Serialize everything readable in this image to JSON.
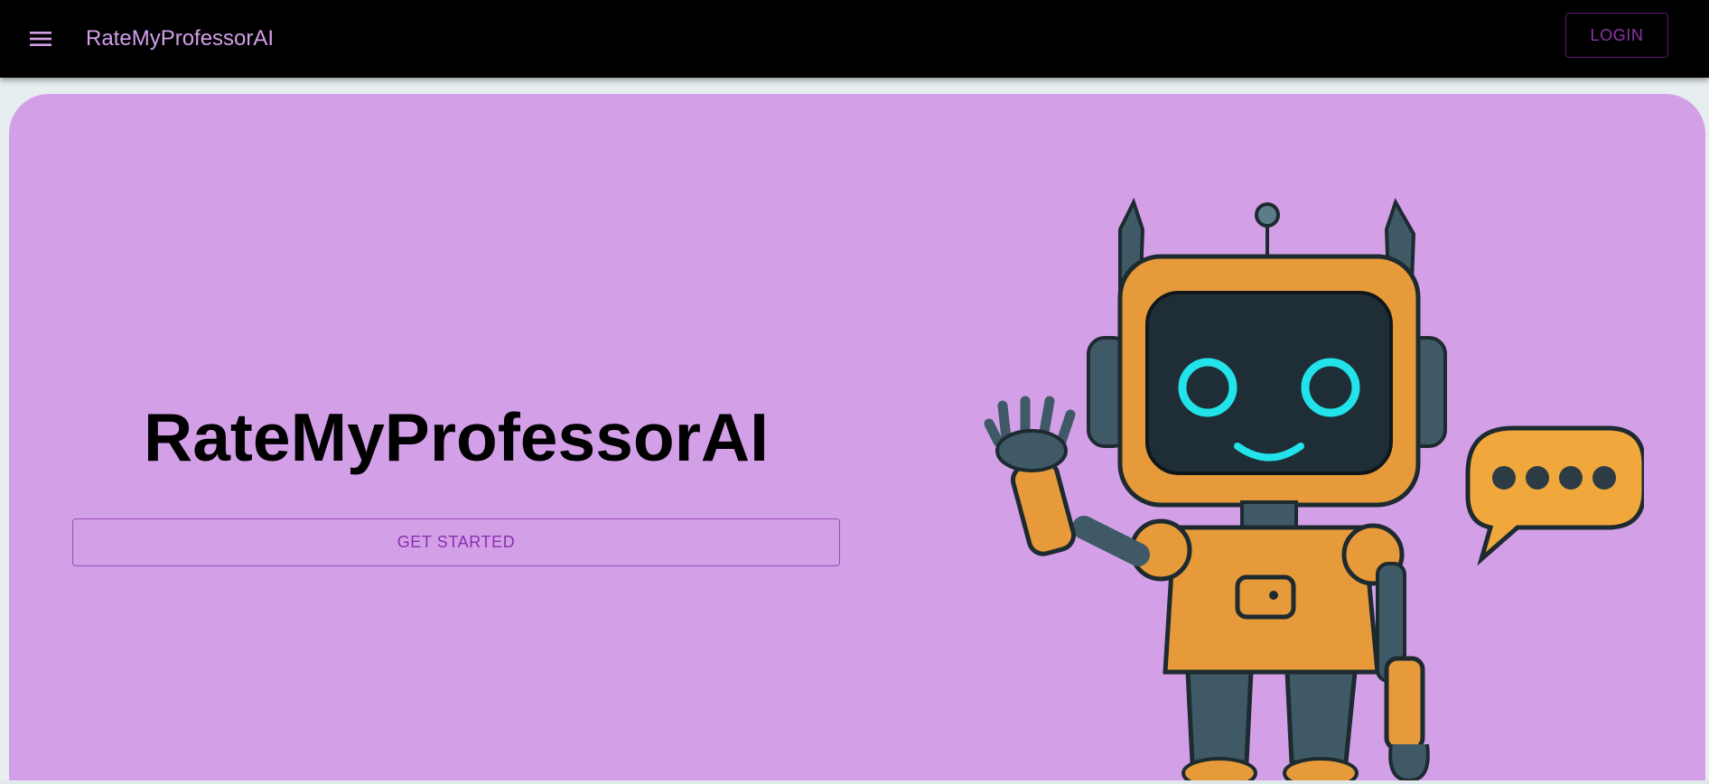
{
  "appbar": {
    "menu_icon": "hamburger-menu-icon",
    "title": "RateMyProfessorAI",
    "login_label": "LOGIN"
  },
  "hero": {
    "title": "RateMyProfessorAI",
    "cta_label": "GET STARTED",
    "illustration": "waving-robot-with-speech-bubble"
  },
  "colors": {
    "appbar_bg": "#000000",
    "brand_text": "#d39fe8",
    "hero_bg": "#d3a0e8",
    "accent": "#8a2fae",
    "robot_body": "#e69a3a",
    "robot_eyes": "#22e3ea"
  }
}
